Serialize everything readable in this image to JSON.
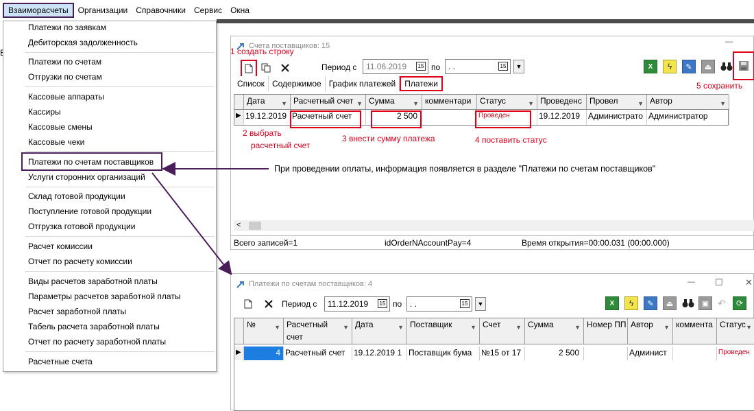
{
  "menubar": {
    "items": [
      "Взаиморасчеты",
      "Организации",
      "Справочники",
      "Сервис",
      "Окна"
    ]
  },
  "sidebar_letter": "В",
  "dropdown": {
    "items": [
      "Платежи по заявкам",
      "Дебиторская задолженность",
      "Платежи по счетам",
      "Отгрузки по счетам",
      "Кассовые аппараты",
      "Кассиры",
      "Кассовые смены",
      "Кассовые чеки",
      "Платежи по счетам поставщиков",
      "Услуги сторонних организаций",
      "Склад готовой продукции",
      "Поступление готовой продукции",
      "Отгрузка готовой продукции",
      "Расчет комиссии",
      "Отчет по расчету комиссии",
      "Виды расчетов заработной платы",
      "Параметры расчетов заработной платы",
      "Расчет заработной платы",
      "Табель расчета заработной платы",
      "Отчет по расчету заработной платы",
      "Расчетные счета"
    ]
  },
  "win1": {
    "title": "Счета поставщиков: 15",
    "minimize": "—",
    "period_label": "Период с",
    "date_from": "11.06.2019",
    "to_label": "по",
    "date_to": ".  .",
    "cal": "15",
    "tabs": [
      "Список",
      "Содержимое",
      "График платежей",
      "Платежи"
    ],
    "columns": [
      "Дата",
      "Расчетный счет",
      "Сумма",
      "комментари",
      "Статус",
      "Проведенс",
      "Провел",
      "Автор"
    ],
    "row": [
      "19.12.2019",
      "Расчетный счет",
      "2 500",
      "",
      "Проведен",
      "19.12.2019",
      "Администрато",
      "Администратор"
    ],
    "status": {
      "records": "Всего записей=1",
      "id": "idOrderNAccountPay=4",
      "time": "Время открытия=00:00.031 (00:00.000)"
    },
    "scroll_left": "<"
  },
  "win2": {
    "title": "Платежи по счетам поставщиков: 4",
    "minimize": "—",
    "maximize": "☐",
    "close": "✕",
    "period_label": "Период с",
    "date_from": "11.12.2019",
    "to_label": "по",
    "date_to": ".  .",
    "cal": "15",
    "columns": [
      "№",
      "Расчетный счет",
      "Дата",
      "Поставщик",
      "Счет",
      "Сумма",
      "Номер ПП",
      "Автор",
      "коммента",
      "Статус"
    ],
    "row": [
      "4",
      "Расчетный счет",
      "19.12.2019 1",
      "Поставщик бума",
      "№15 от 17",
      "2 500",
      "",
      "Админист",
      "",
      "Проведен"
    ]
  },
  "notes": {
    "n1": "1 создать строку",
    "n2a": "2 выбрать",
    "n2b": "расчетный счет",
    "n3": "3 внести сумму платежа",
    "n4": "4 поставить статус",
    "n5": "5 сохранить",
    "arrow": "При проведении оплаты, информация появляется в разделе \"Платежи по счетам поставщиков\""
  },
  "colors": {
    "red": "#e0001b",
    "purple": "#4b1e5a",
    "menu_highlight": "#cde4f7"
  },
  "icons": {
    "excel": "X",
    "lightning": "ϟ",
    "binoculars": "👓"
  }
}
